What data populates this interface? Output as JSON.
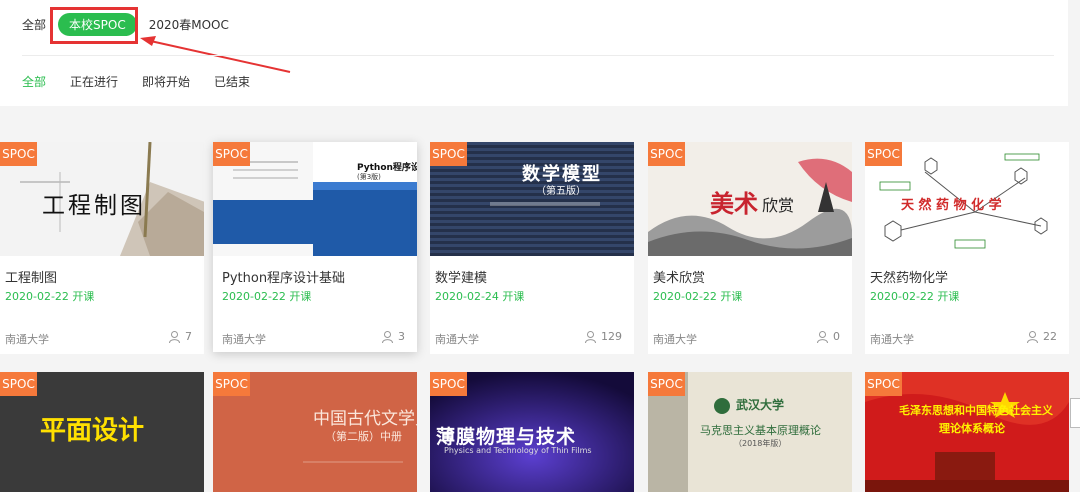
{
  "filters": {
    "all": "全部",
    "spoc": "本校SPOC",
    "mooc": "2020春MOOC"
  },
  "status_tabs": [
    "全部",
    "正在进行",
    "即将开始",
    "已结束"
  ],
  "badge": "SPOC",
  "courses": [
    {
      "title": "工程制图",
      "date": "2020-02-22 开课",
      "school": "南通大学",
      "count": "7",
      "cover_text": "工程制图"
    },
    {
      "title": "Python程序设计基础",
      "date": "2020-02-22 开课",
      "school": "南通大学",
      "count": "3",
      "cover_text": "Python程序设计基础",
      "cover_sub": "(第3版)"
    },
    {
      "title": "数学建模",
      "date": "2020-02-24 开课",
      "school": "南通大学",
      "count": "129",
      "cover_text": "数学模型",
      "cover_sub": "（第五版）"
    },
    {
      "title": "美术欣赏",
      "date": "2020-02-22 开课",
      "school": "南通大学",
      "count": "0",
      "cover_text_a": "美术",
      "cover_text_b": "欣赏"
    },
    {
      "title": "天然药物化学",
      "date": "2020-02-22 开课",
      "school": "南通大学",
      "count": "22",
      "cover_text": "天 然 药 物 化 学"
    }
  ],
  "courses_row2": [
    {
      "cover_text": "平面设计"
    },
    {
      "cover_text": "中国古代文学史",
      "cover_sub": "（第二版）中册"
    },
    {
      "cover_text": "薄膜物理与技术",
      "cover_sub": "Physics and Technology of Thin Films"
    },
    {
      "cover_text": "武汉大学",
      "cover_sub": "马克思主义基本原理概论",
      "cover_sub2": "（2018年版）"
    },
    {
      "cover_text": "毛泽东思想和中国特色社会主义",
      "cover_sub": "理论体系概论"
    }
  ],
  "colors": {
    "accent": "#2bbd4f",
    "badge": "#f5793b",
    "annotation": "#e53333"
  }
}
